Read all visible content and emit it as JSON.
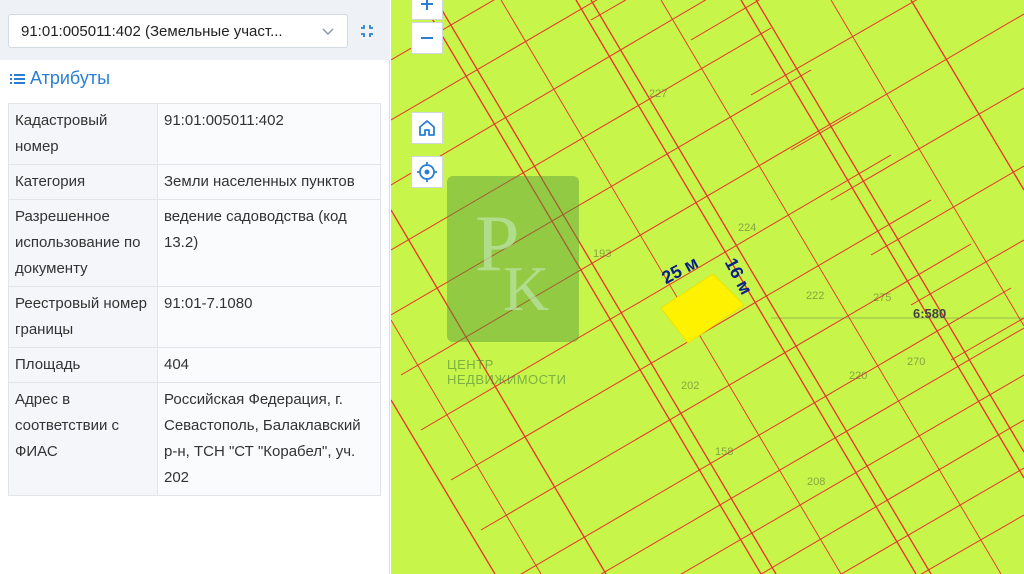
{
  "selector": {
    "value": "91:01:005011:402 (Земельные участ..."
  },
  "attributes": {
    "title": "Атрибуты",
    "rows": [
      {
        "key": "Кадастровый номер",
        "value": "91:01:005011:402"
      },
      {
        "key": "Категория",
        "value": "Земли населенных пунктов"
      },
      {
        "key": "Разрешенное использование по документу",
        "value": "ведение садоводства (код 13.2)"
      },
      {
        "key": "Реестровый номер границы",
        "value": "91:01-7.1080"
      },
      {
        "key": "Площадь",
        "value": "404"
      },
      {
        "key": "Адрес в соответствии с ФИАС",
        "value": "Российская Федерация, г. Севастополь, Балаклавский р-н, ТСН \"СТ \"Корабел\", уч. 202"
      }
    ]
  },
  "map": {
    "dim_length": "25 м",
    "dim_width": "16 м",
    "boundary_label": "6:580",
    "watermark": "ЦЕНТР НЕДВИЖИМОСТИ",
    "parcel_numbers": [
      "227",
      "224",
      "222",
      "275",
      "220",
      "270",
      "193",
      "158",
      "208",
      "202"
    ],
    "colors": {
      "map_bg": "#c8f54a",
      "lines": "#e8322a",
      "parcel": "#fff200",
      "accent": "#2a7fd4"
    },
    "icons": [
      "zoom-in-icon",
      "zoom-out-icon",
      "home-icon",
      "locate-icon"
    ]
  }
}
